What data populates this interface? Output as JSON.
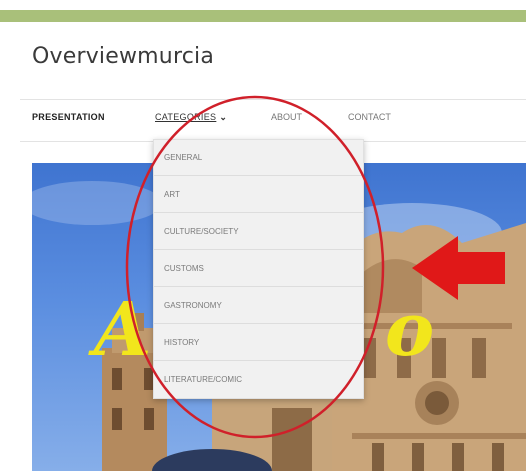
{
  "site": {
    "title": "Overviewmurcia"
  },
  "nav": {
    "presentation": "PRESENTATION",
    "categories": "CATEGORIES",
    "about": "ABOUT",
    "contact": "CONTACT"
  },
  "dropdown": {
    "items": [
      "GENERAL",
      "ART",
      "CULTURE/SOCIETY",
      "CUSTOMS",
      "GASTRONOMY",
      "HISTORY",
      "LITERATURE/COMIC"
    ]
  },
  "hero": {
    "overlay_text": "A   view o"
  },
  "colors": {
    "topbar": "#a9c07a",
    "highlight_circle": "#d0202a",
    "arrow": "#e01818",
    "hero_text": "#f2e61c"
  }
}
